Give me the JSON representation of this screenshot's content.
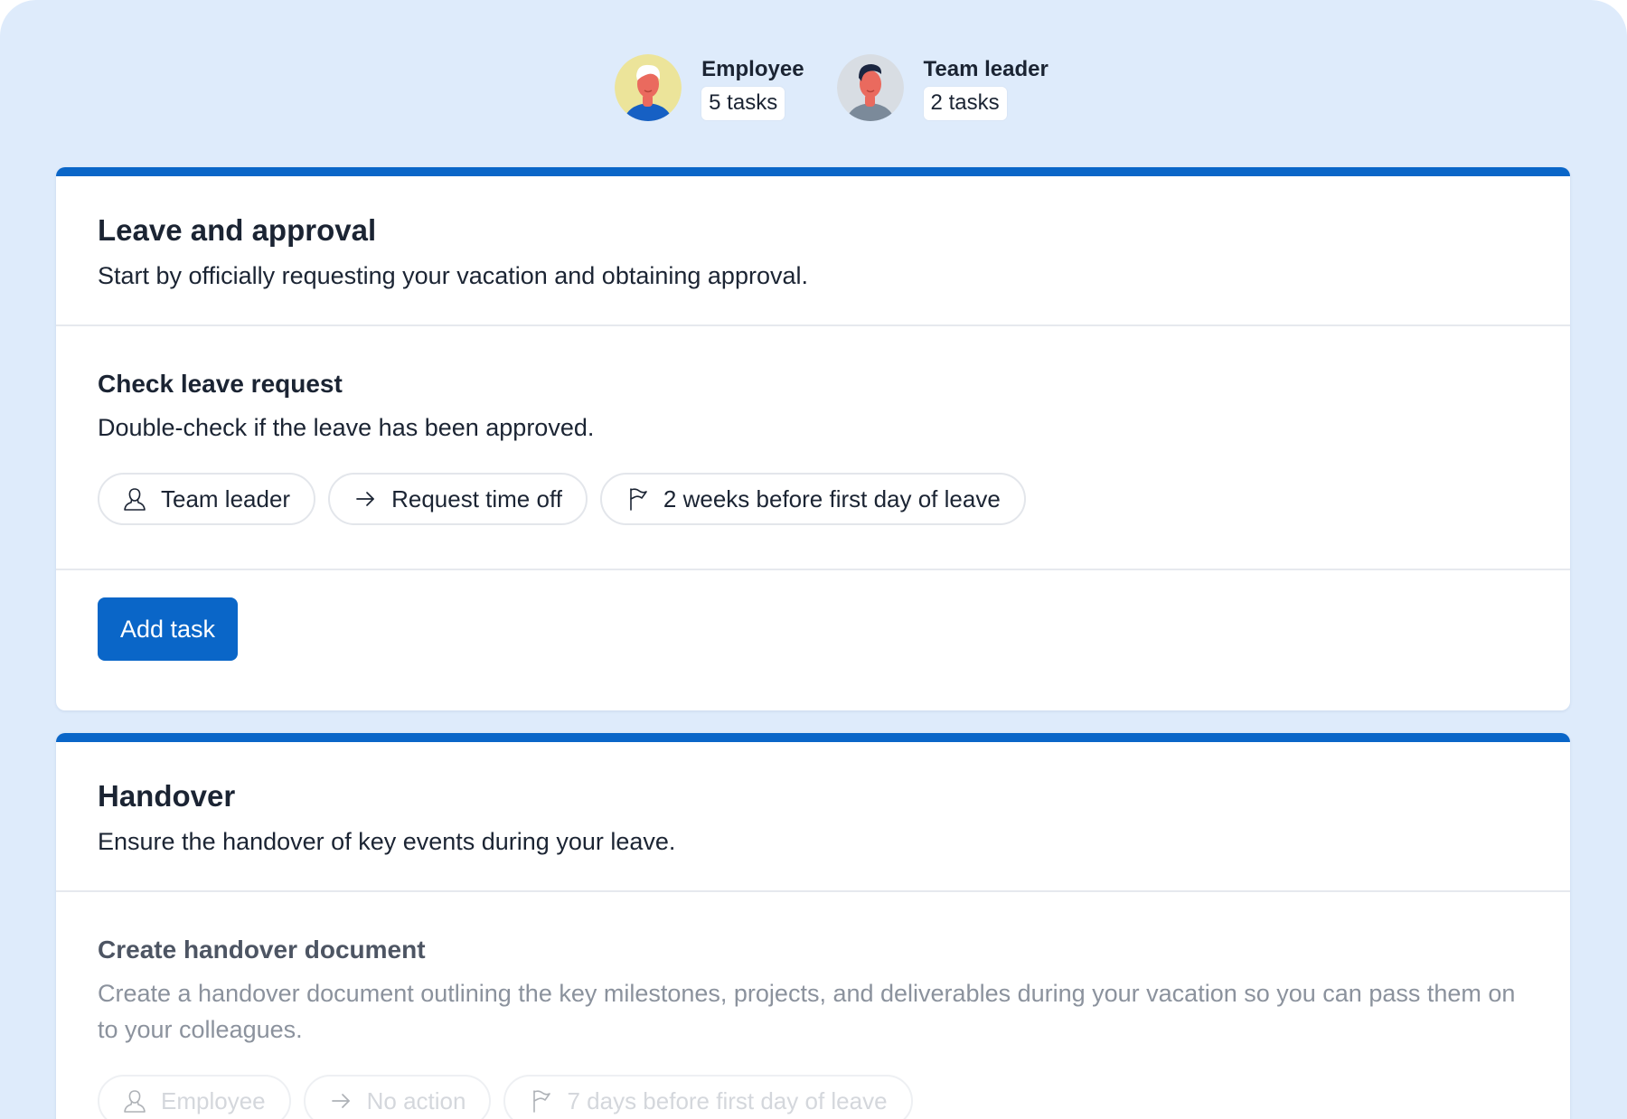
{
  "assignees": [
    {
      "name": "Employee",
      "tasks": "5 tasks",
      "avatar_icon": "employee-avatar"
    },
    {
      "name": "Team leader",
      "tasks": "2 tasks",
      "avatar_icon": "team-leader-avatar"
    }
  ],
  "colors": {
    "background": "#deebfb",
    "accent": "#0a66c8",
    "card": "#ffffff",
    "text": "#1b2433"
  },
  "sections": [
    {
      "title": "Leave and approval",
      "description": "Start by officially requesting your vacation and obtaining approval.",
      "task": {
        "title": "Check leave request",
        "description": "Double-check if the leave has been approved.",
        "chips": [
          {
            "icon": "person-icon",
            "label": "Team leader"
          },
          {
            "icon": "arrow-right-icon",
            "label": "Request time off"
          },
          {
            "icon": "flag-icon",
            "label": "2 weeks before first day of leave"
          }
        ]
      },
      "add_task_label": "Add task"
    },
    {
      "title": "Handover",
      "description": "Ensure the handover of key events during your leave.",
      "task": {
        "title": "Create handover document",
        "description": "Create a handover document outlining the key milestones, projects, and deliverables during your vacation so you can pass them on to your colleagues.",
        "chips": [
          {
            "icon": "person-icon",
            "label": "Employee"
          },
          {
            "icon": "arrow-right-icon",
            "label": "No action"
          },
          {
            "icon": "flag-icon",
            "label": "7 days before first day of leave"
          }
        ]
      }
    }
  ]
}
